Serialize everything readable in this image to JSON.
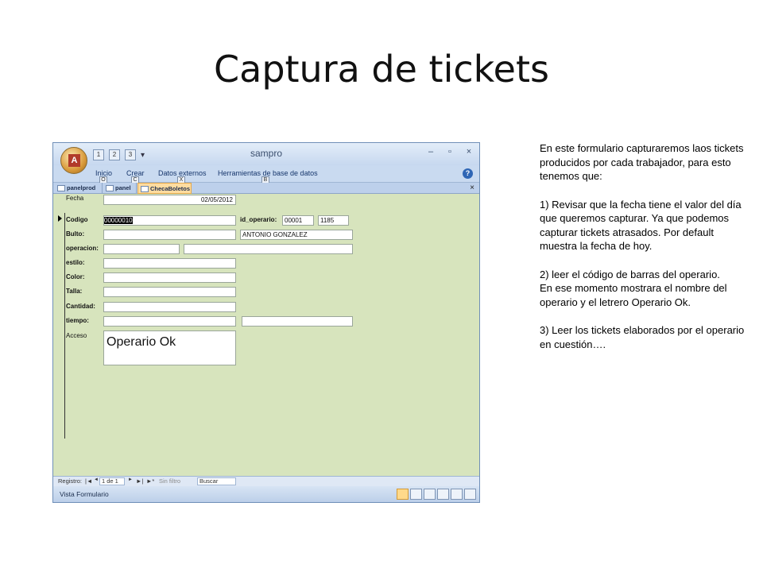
{
  "slide": {
    "title": "Captura de tickets"
  },
  "app": {
    "title": "sampro",
    "quick_access": [
      "1",
      "2",
      "3"
    ],
    "window_controls": [
      "–",
      "▫",
      "×"
    ],
    "ribbon_tabs": [
      {
        "label": "Inicio",
        "keytip": "O"
      },
      {
        "label": "Crear",
        "keytip": "C"
      },
      {
        "label": "Datos externos",
        "keytip": "X"
      },
      {
        "label": "Herramientas de base de datos",
        "keytip": "B"
      }
    ],
    "help_symbol": "?",
    "doc_tabs": [
      {
        "label": "panelprod",
        "active": false
      },
      {
        "label": "panel",
        "active": false
      },
      {
        "label": "ChecaBoletos",
        "active": true
      }
    ],
    "doc_close": "×"
  },
  "form": {
    "fecha_label": "Fecha",
    "fecha_value": "02/05/2012",
    "codigo_label": "Codigo",
    "codigo_value": "00000010",
    "id_operario_label": "id_operario:",
    "id_operario_value": "00001",
    "id_operario_extra": "1185",
    "bulto_label": "Bulto:",
    "bulto_value": "",
    "operario_name": "ANTONIO GONZALEZ",
    "operacion_label": "operacion:",
    "operacion_value": "",
    "operacion_desc": "",
    "estilo_label": "estilo:",
    "estilo_value": "",
    "color_label": "Color:",
    "color_value": "",
    "talla_label": "Talla:",
    "talla_value": "",
    "cantidad_label": "Cantidad:",
    "cantidad_value": "",
    "tiempo_label": "tiempo:",
    "tiempo_value": "",
    "tiempo_extra": "",
    "acceso_label": "Acceso",
    "acceso_value": "Operario Ok"
  },
  "nav": {
    "registro_label": "Registro:",
    "first": "|◄",
    "prev": "◄",
    "record": "1 de 1",
    "next": "►",
    "last": "►|",
    "new": "►*",
    "filter": "Sin filtro",
    "search": "Buscar"
  },
  "status": {
    "text": "Vista Formulario"
  },
  "instructions": {
    "p1": "En este formulario capturaremos laos tickets producidos por cada trabajador, para esto tenemos que:",
    "p2": "1) Revisar que la fecha tiene el valor del día que queremos capturar. Ya que podemos capturar tickets atrasados. Por default muestra la fecha de hoy.",
    "p3a": "2) leer el código de barras del operario.",
    "p3b": "En ese momento mostrara el nombre del operario y el letrero Operario Ok.",
    "p4": "3) Leer los tickets elaborados por el operario en cuestión…."
  }
}
